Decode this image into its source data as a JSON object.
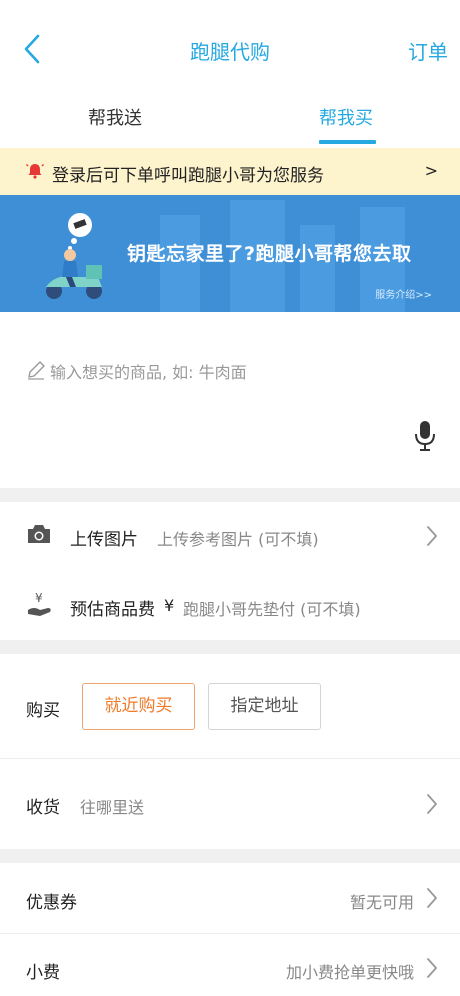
{
  "header": {
    "title": "跑腿代购",
    "right_label": "订单"
  },
  "tabs": [
    {
      "label": "帮我送",
      "active": false
    },
    {
      "label": "帮我买",
      "active": true
    }
  ],
  "notice": {
    "text": "登录后可下单呼叫跑腿小哥为您服务",
    "arrow": ">"
  },
  "banner": {
    "headline": "钥匙忘家里了?跑腿小哥帮您去取",
    "link": "服务介绍>>"
  },
  "input": {
    "placeholder": "输入想买的商品, 如: 牛肉面"
  },
  "upload": {
    "label": "上传图片",
    "hint": "上传参考图片 (可不填)"
  },
  "fee": {
    "label": "预估商品费",
    "currency": "¥",
    "hint": "跑腿小哥先垫付 (可不填)"
  },
  "buy": {
    "label": "购买",
    "option_near": "就近购买",
    "option_addr": "指定地址"
  },
  "deliver": {
    "label": "收货",
    "hint": "往哪里送"
  },
  "coupon": {
    "label": "优惠券",
    "value": "暂无可用"
  },
  "tip": {
    "label": "小费",
    "value": "加小费抢单更快哦"
  },
  "colors": {
    "accent": "#25a9e0",
    "orange": "#f07a2a",
    "notice_bg": "#fdf3cc",
    "banner_bg": "#3e8fd6"
  }
}
